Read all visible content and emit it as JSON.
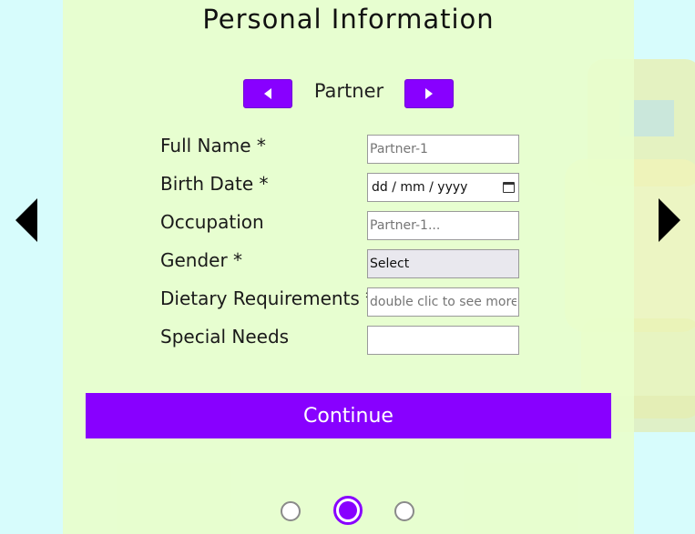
{
  "header": {
    "title": "Personal Information"
  },
  "person_nav": {
    "current": "Partner"
  },
  "fields": [
    {
      "label": "Full Name *",
      "placeholder": "Partner-1",
      "value": ""
    },
    {
      "label": "Birth Date *",
      "value": "dd / mm / yyyy"
    },
    {
      "label": "Occupation",
      "placeholder": "Partner-1...",
      "value": ""
    },
    {
      "label": "Gender *",
      "value": "Select"
    },
    {
      "label": "Dietary Requirements *",
      "placeholder": "double clic to see more",
      "value": ""
    },
    {
      "label": "Special Needs",
      "value": ""
    }
  ],
  "actions": {
    "continue_label": "Continue"
  },
  "pagination": {
    "total": 3,
    "active_index": 1
  },
  "colors": {
    "accent": "#8800ff",
    "panel": "#e8fecc",
    "page_bg": "#d7fcfc"
  }
}
